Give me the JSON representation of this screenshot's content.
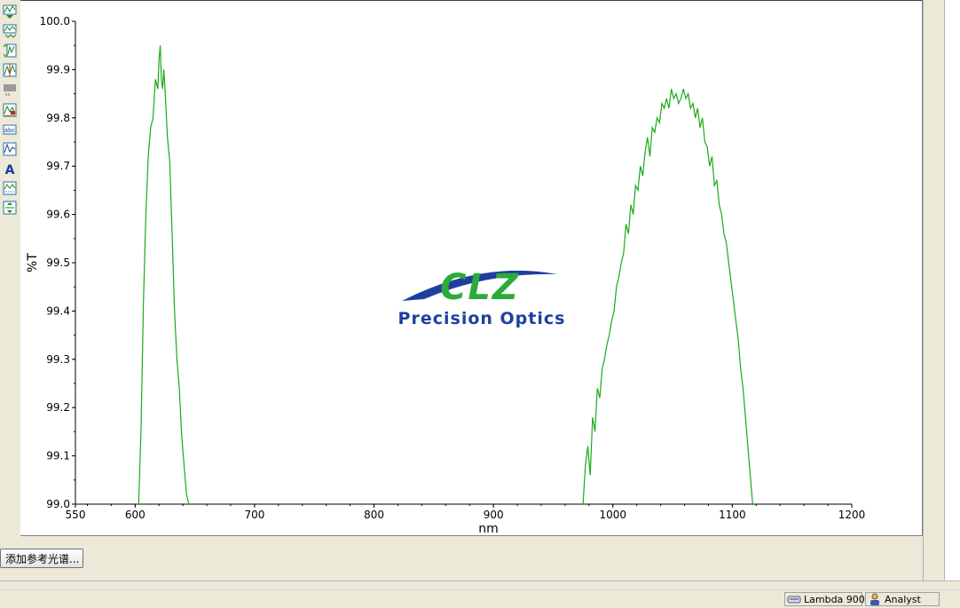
{
  "toolbar": {
    "items": [
      {
        "icon": "spectrum-view-icon"
      },
      {
        "icon": "overlay-icon"
      },
      {
        "icon": "stack-icon"
      },
      {
        "icon": "marker-icon"
      },
      {
        "icon": "annotation-icon"
      },
      {
        "icon": "peak-pick-icon"
      },
      {
        "icon": "label-icon",
        "text": "abc"
      },
      {
        "icon": "auto-scale-icon"
      },
      {
        "icon": "text-icon",
        "text": "A"
      },
      {
        "icon": "grid-icon"
      },
      {
        "icon": "scale-icon"
      }
    ]
  },
  "logo": {
    "brand": "CLZ",
    "tagline": "Precision Optics",
    "colors": {
      "green": "#2daa3c",
      "blue": "#1f3f9f"
    }
  },
  "chart_data": {
    "type": "line",
    "title": "",
    "xlabel": "nm",
    "ylabel": "%T",
    "xlim": [
      550,
      1200
    ],
    "ylim": [
      99.0,
      100.0
    ],
    "xticks": [
      550,
      600,
      700,
      800,
      900,
      1000,
      1100,
      1200
    ],
    "xtick_labels": [
      "550",
      "600",
      "700",
      "800",
      "900",
      "1000",
      "1100",
      "1200"
    ],
    "yticks": [
      99.0,
      99.1,
      99.2,
      99.3,
      99.4,
      99.5,
      99.6,
      99.7,
      99.8,
      99.9,
      100.0
    ],
    "ytick_labels": [
      "99.0",
      "99.1",
      "99.2",
      "99.3",
      "99.4",
      "99.5",
      "99.6",
      "99.7",
      "99.8",
      "99.9",
      "100.0"
    ],
    "grid": false,
    "series": [
      {
        "color": "#1aaa1a",
        "segments": [
          {
            "x": [
              603,
              605,
              607,
              609,
              611,
              613,
              615,
              617,
              619,
              620,
              621,
              622,
              623,
              624,
              625,
              627,
              629,
              631,
              633,
              635,
              637,
              639,
              641,
              643,
              645
            ],
            "y": [
              99.0,
              99.16,
              99.42,
              99.6,
              99.72,
              99.78,
              99.8,
              99.88,
              99.86,
              99.92,
              99.95,
              99.88,
              99.86,
              99.9,
              99.86,
              99.76,
              99.71,
              99.56,
              99.4,
              99.3,
              99.24,
              99.14,
              99.08,
              99.02,
              99.0
            ]
          },
          {
            "x": [
              975,
              977,
              979,
              981,
              983,
              985,
              987,
              989,
              991,
              993,
              995,
              997,
              999,
              1001,
              1003,
              1005,
              1007,
              1009,
              1011,
              1013,
              1015,
              1017,
              1019,
              1021,
              1023,
              1025,
              1027,
              1029,
              1031,
              1033,
              1035,
              1037,
              1039,
              1041,
              1043,
              1045,
              1047,
              1049,
              1051,
              1053,
              1055,
              1057,
              1059,
              1061,
              1063,
              1065,
              1067,
              1069,
              1071,
              1073,
              1075,
              1077,
              1079,
              1081,
              1083,
              1085,
              1087,
              1089,
              1091,
              1093,
              1095,
              1097,
              1099,
              1101,
              1103,
              1105,
              1107,
              1109,
              1111,
              1113,
              1115,
              1117
            ],
            "y": [
              99.0,
              99.08,
              99.12,
              99.06,
              99.18,
              99.15,
              99.24,
              99.22,
              99.28,
              99.3,
              99.33,
              99.35,
              99.38,
              99.4,
              99.45,
              99.47,
              99.5,
              99.52,
              99.58,
              99.56,
              99.62,
              99.6,
              99.66,
              99.65,
              99.7,
              99.68,
              99.73,
              99.76,
              99.72,
              99.78,
              99.77,
              99.8,
              99.79,
              99.83,
              99.82,
              99.84,
              99.82,
              99.86,
              99.84,
              99.85,
              99.83,
              99.84,
              99.86,
              99.84,
              99.85,
              99.82,
              99.83,
              99.8,
              99.82,
              99.78,
              99.8,
              99.75,
              99.74,
              99.7,
              99.72,
              99.66,
              99.67,
              99.62,
              99.6,
              99.56,
              99.54,
              99.5,
              99.46,
              99.42,
              99.38,
              99.34,
              99.28,
              99.24,
              99.18,
              99.12,
              99.06,
              99.0
            ]
          }
        ]
      }
    ]
  },
  "actions": {
    "add_reference_label": "添加参考光谱..."
  },
  "status": {
    "instrument": "Lambda 900",
    "user": "Analyst"
  }
}
